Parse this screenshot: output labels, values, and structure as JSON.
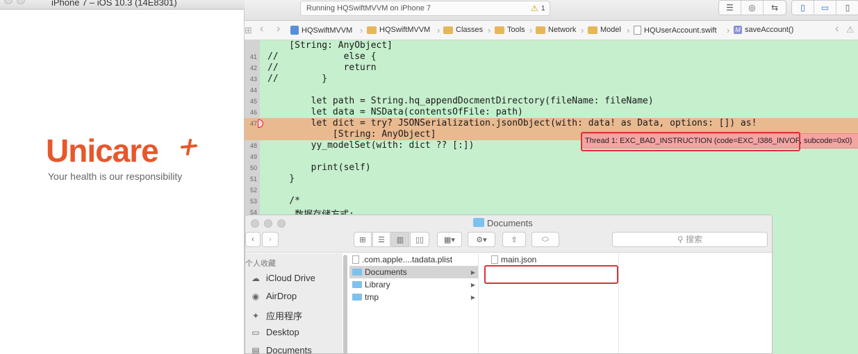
{
  "simulator": {
    "title": "iPhone 7 – iOS 10.3 (14E8301)",
    "logo": "Unicare",
    "tagline": "Your health is our responsibility"
  },
  "xcode": {
    "status": {
      "text": "Running HQSwiftMVVM on iPhone 7",
      "warning_count": "1"
    },
    "jumpbar": {
      "nav_back": "‹",
      "nav_fwd": "›",
      "crumbs": [
        "HQSwiftMVVM",
        "HQSwiftMVVM",
        "Classes",
        "Tools",
        "Network",
        "Model",
        "HQUserAccount.swift",
        "saveAccount()"
      ],
      "method_badge": "M"
    },
    "code": {
      "lines": [
        {
          "n": "",
          "t": "    [String: AnyObject]"
        },
        {
          "n": "41",
          "t": "//            else {"
        },
        {
          "n": "42",
          "t": "//            return"
        },
        {
          "n": "43",
          "t": "//        }"
        },
        {
          "n": "44",
          "t": ""
        },
        {
          "n": "45",
          "t": "        let path = String.hq_appendDocmentDirectory(fileName: fileName)"
        },
        {
          "n": "46",
          "t": "        let data = NSData(contentsOfFile: path)"
        },
        {
          "n": "47",
          "t": "        let dict = try? JSONSerialization.jsonObject(with: data! as Data, options: []) as!"
        },
        {
          "n": "",
          "t": "            [String: AnyObject]"
        },
        {
          "n": "48",
          "t": "        yy_modelSet(with: dict ?? [:])"
        },
        {
          "n": "49",
          "t": ""
        },
        {
          "n": "50",
          "t": "        print(self)"
        },
        {
          "n": "51",
          "t": "    }"
        },
        {
          "n": "52",
          "t": ""
        },
        {
          "n": "53",
          "t": "    /*"
        },
        {
          "n": "54",
          "t": "     数据存储方式:"
        }
      ],
      "error_text": "Thread 1: EXC_BAD_INSTRUCTION (code=EXC_I386_INVOP, subcode=0x0)"
    }
  },
  "finder": {
    "title": "Documents",
    "search_placeholder": "搜索",
    "sidebar_heading": "个人收藏",
    "sidebar_items": [
      {
        "label": "iCloud Drive",
        "icon": "cloud-icon"
      },
      {
        "label": "AirDrop",
        "icon": "airdrop-icon"
      },
      {
        "label": "应用程序",
        "icon": "applications-icon"
      },
      {
        "label": "Desktop",
        "icon": "desktop-icon"
      },
      {
        "label": "Documents",
        "icon": "documents-icon"
      }
    ],
    "column1": [
      {
        "label": ".com.apple....tadata.plist",
        "kind": "file",
        "selected": false
      },
      {
        "label": "Documents",
        "kind": "folder",
        "selected": true
      },
      {
        "label": "Library",
        "kind": "folder",
        "selected": false
      },
      {
        "label": "tmp",
        "kind": "folder",
        "selected": false
      }
    ],
    "column2": [
      {
        "label": "main.json",
        "kind": "file"
      }
    ]
  }
}
